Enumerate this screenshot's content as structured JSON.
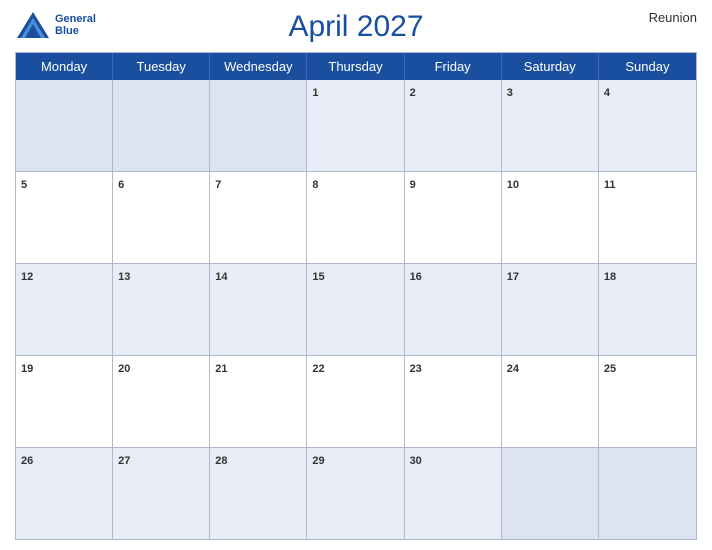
{
  "header": {
    "logo": {
      "line1": "General",
      "line2": "Blue"
    },
    "title": "April 2027",
    "region": "Reunion"
  },
  "calendar": {
    "day_headers": [
      "Monday",
      "Tuesday",
      "Wednesday",
      "Thursday",
      "Friday",
      "Saturday",
      "Sunday"
    ],
    "weeks": [
      [
        {
          "num": "",
          "empty": true
        },
        {
          "num": "",
          "empty": true
        },
        {
          "num": "",
          "empty": true
        },
        {
          "num": "1"
        },
        {
          "num": "2"
        },
        {
          "num": "3"
        },
        {
          "num": "4"
        }
      ],
      [
        {
          "num": "5"
        },
        {
          "num": "6"
        },
        {
          "num": "7"
        },
        {
          "num": "8"
        },
        {
          "num": "9"
        },
        {
          "num": "10"
        },
        {
          "num": "11"
        }
      ],
      [
        {
          "num": "12"
        },
        {
          "num": "13"
        },
        {
          "num": "14"
        },
        {
          "num": "15"
        },
        {
          "num": "16"
        },
        {
          "num": "17"
        },
        {
          "num": "18"
        }
      ],
      [
        {
          "num": "19"
        },
        {
          "num": "20"
        },
        {
          "num": "21"
        },
        {
          "num": "22"
        },
        {
          "num": "23"
        },
        {
          "num": "24"
        },
        {
          "num": "25"
        }
      ],
      [
        {
          "num": "26"
        },
        {
          "num": "27"
        },
        {
          "num": "28"
        },
        {
          "num": "29"
        },
        {
          "num": "30"
        },
        {
          "num": "",
          "empty": true
        },
        {
          "num": "",
          "empty": true
        }
      ]
    ]
  },
  "colors": {
    "header_bg": "#1a4fa0",
    "alt_row_bg": "#e8ecf7",
    "white_row_bg": "#ffffff"
  }
}
